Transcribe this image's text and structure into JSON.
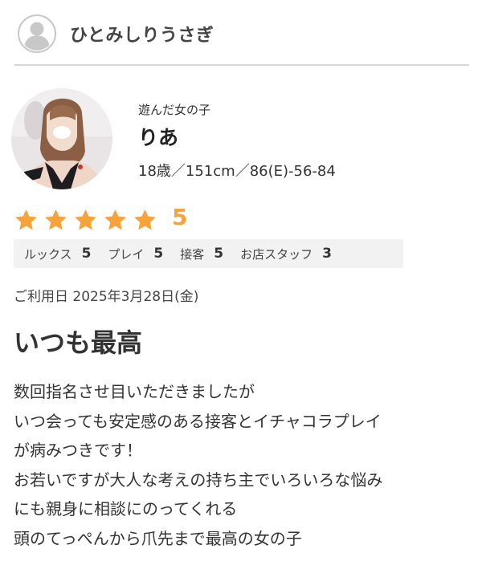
{
  "reviewer": {
    "name": "ひとみしりうさぎ",
    "avatar_icon": "user-avatar-icon"
  },
  "girl": {
    "label": "遊んだ女の子",
    "name": "りあ",
    "stats": "18歳／151cm／86(E)-56-84",
    "photo": "girl-photo"
  },
  "rating": {
    "stars": 5,
    "max_stars": 5,
    "score": "5",
    "star_color": "#f5a33a",
    "items": [
      {
        "label": "ルックス",
        "value": "5"
      },
      {
        "label": "プレイ",
        "value": "5"
      },
      {
        "label": "接客",
        "value": "5"
      },
      {
        "label": "お店スタッフ",
        "value": "3"
      }
    ]
  },
  "visit_date": "ご利用日 2025年3月28日(金)",
  "review": {
    "title": "いつも最高",
    "lines": [
      "数回指名させ目いただきましたが",
      "いつ会っても安定感のある接客とイチャコラプレイ",
      "が病みつきです！",
      "お若いですが大人な考えの持ち主でいろいろな悩み",
      "にも親身に相談にのってくれる",
      "頭のてっぺんから爪先まで最高の女の子"
    ]
  }
}
